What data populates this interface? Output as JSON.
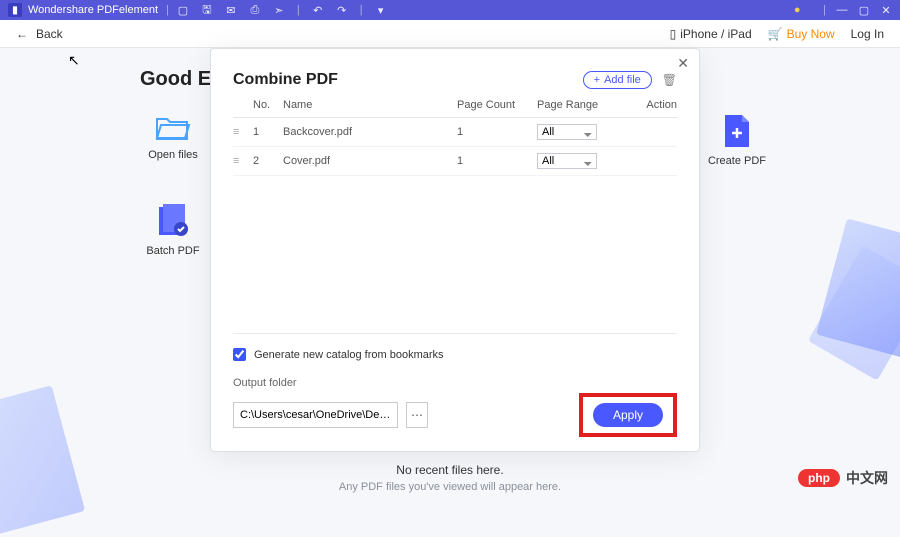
{
  "titlebar": {
    "app_name": "Wondershare PDFelement"
  },
  "topbar": {
    "back": "Back",
    "device": "iPhone / iPad",
    "buy": "Buy Now",
    "login": "Log In"
  },
  "greeting": "Good Evening",
  "tiles": {
    "open": "Open files",
    "create": "Create PDF",
    "batch": "Batch PDF"
  },
  "recent": {
    "line1": "No recent files here.",
    "line2": "Any PDF files you've viewed will appear here."
  },
  "modal": {
    "title": "Combine PDF",
    "add_file": "Add file",
    "columns": {
      "no": "No.",
      "name": "Name",
      "count": "Page Count",
      "range": "Page Range",
      "action": "Action"
    },
    "rows": [
      {
        "no": "1",
        "name": "Backcover.pdf",
        "count": "1",
        "range": "All"
      },
      {
        "no": "2",
        "name": "Cover.pdf",
        "count": "1",
        "range": "All"
      }
    ],
    "checkbox_label": "Generate new catalog from bookmarks",
    "output_label": "Output folder",
    "output_path": "C:\\Users\\cesar\\OneDrive\\Desktop\\PDFelem",
    "apply": "Apply"
  },
  "badge": {
    "pill": "php",
    "text": "中文网"
  }
}
